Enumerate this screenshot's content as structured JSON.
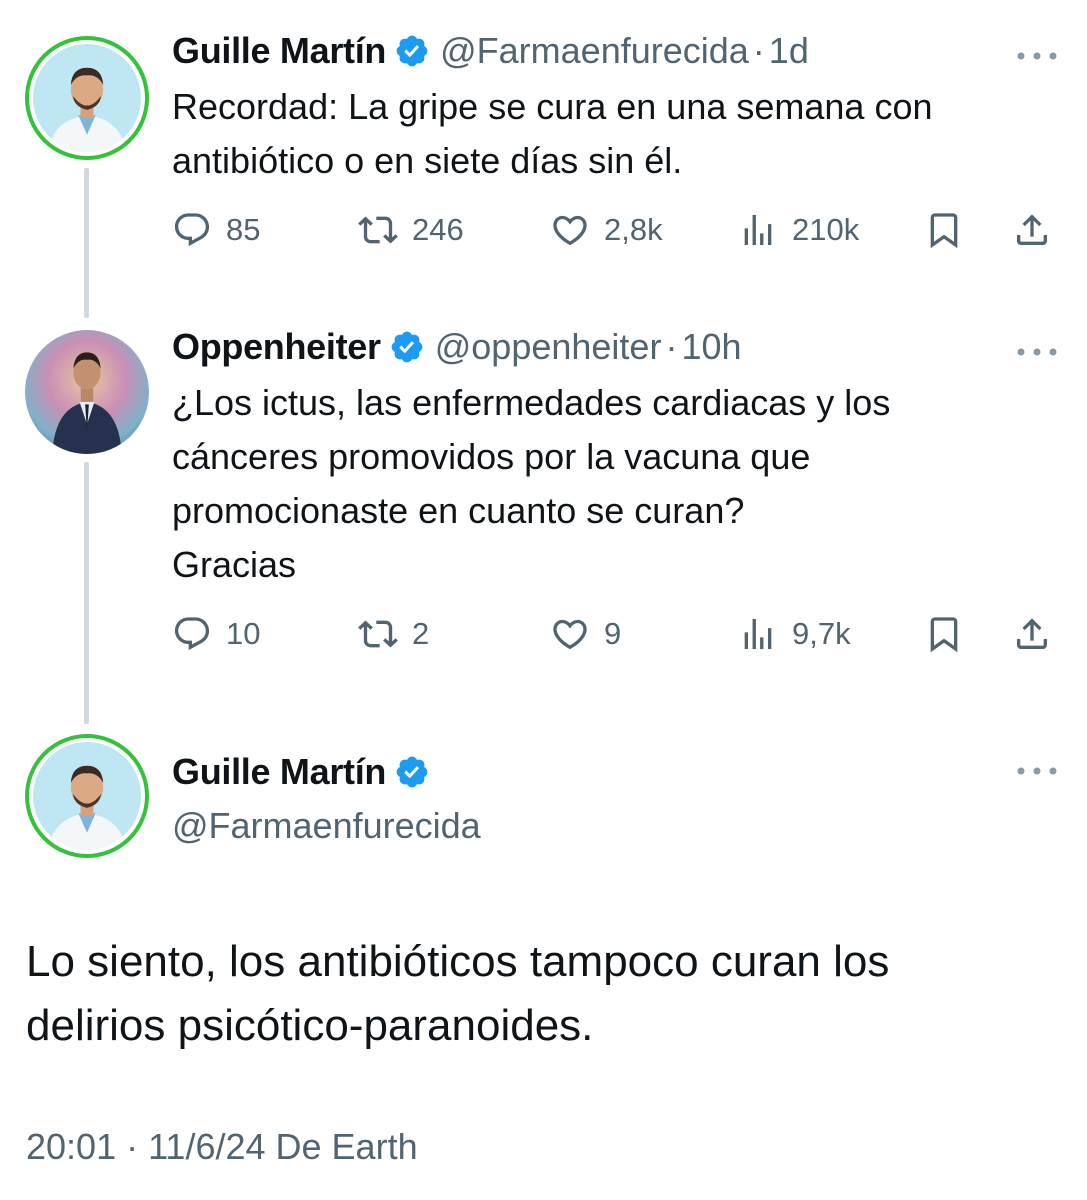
{
  "tweets": [
    {
      "author": "Guille Martín",
      "handle": "@Farmaenfurecida",
      "separator": "·",
      "time": "1d",
      "text_lines": [
        "Recordad: La gripe se cura en una semana con",
        "antibiótico o en siete días sin él."
      ],
      "replies": "85",
      "retweets": "246",
      "likes": "2,8k",
      "views": "210k"
    },
    {
      "author": "Oppenheiter",
      "handle": "@oppenheiter",
      "separator": "·",
      "time": "10h",
      "text_lines": [
        "¿Los ictus, las enfermedades cardiacas y los",
        "cánceres promovidos por la vacuna que",
        "promocionaste en cuanto se curan?",
        "Gracias"
      ],
      "replies": "10",
      "retweets": "2",
      "likes": "9",
      "views": "9,7k"
    }
  ],
  "main_tweet": {
    "author": "Guille Martín",
    "handle": "@Farmaenfurecida",
    "text_lines": [
      "Lo siento, los antibióticos tampoco curan los",
      "delirios psicótico-paranoides."
    ],
    "timestamp": "20:01 · 11/6/24 De Earth"
  },
  "icons": {
    "verified": "verified-badge-icon",
    "more": "more-dots-icon",
    "reply": "reply-icon",
    "retweet": "retweet-icon",
    "like": "heart-icon",
    "views": "views-chart-icon",
    "bookmark": "bookmark-icon",
    "share": "share-icon"
  },
  "colors": {
    "verified": "#1d9bf0",
    "secondary_text": "#536471",
    "thread_line": "#cfd9de",
    "avatar_ring": "#33c23a"
  }
}
